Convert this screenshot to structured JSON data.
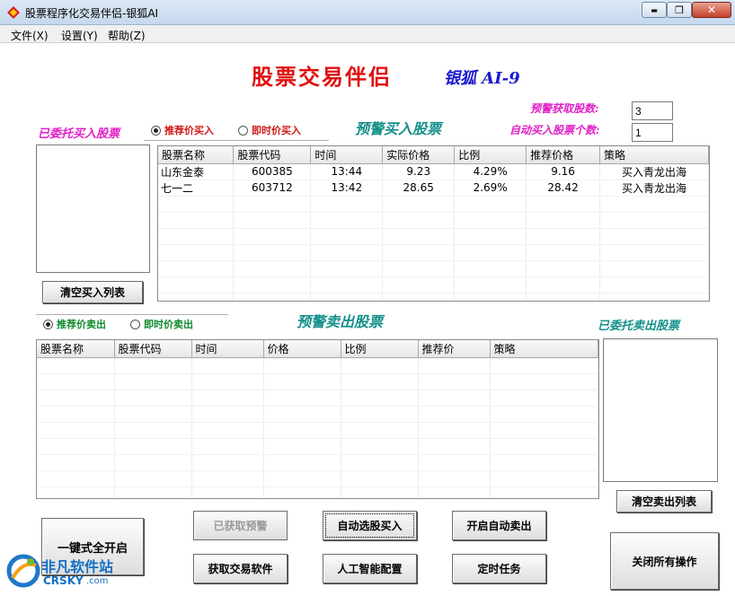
{
  "window": {
    "title": "股票程序化交易伴侣-银狐AI",
    "minimize_glyph": "▬",
    "maximize_glyph": "❐",
    "close_glyph": "✕"
  },
  "menu": [
    {
      "label": "文件(X)"
    },
    {
      "label": "设置(Y)"
    },
    {
      "label": "帮助(Z)"
    }
  ],
  "header": {
    "title": "股票交易伴侣",
    "brand": "银狐 AI-9"
  },
  "settings": {
    "alert_count_label": "预警获取股数:",
    "alert_count_value": "3",
    "auto_buy_label": "自动买入股票个数:",
    "auto_buy_value": "1"
  },
  "buy": {
    "committed_label": "已委托买入股票",
    "radio_recommended": "推荐价买入",
    "radio_instant": "即时价买入",
    "section_title": "预警买入股票",
    "clear_button": "清空买入列表",
    "columns": [
      "股票名称",
      "股票代码",
      "时间",
      "实际价格",
      "比例",
      "推荐价格",
      "策略"
    ],
    "rows": [
      [
        "山东金泰",
        "600385",
        "13:44",
        "9.23",
        "4.29%",
        "9.16",
        "买入青龙出海"
      ],
      [
        "七一二",
        "603712",
        "13:42",
        "28.65",
        "2.69%",
        "28.42",
        "买入青龙出海"
      ]
    ]
  },
  "sell": {
    "radio_recommended": "推荐价卖出",
    "radio_instant": "即时价卖出",
    "section_title": "预警卖出股票",
    "committed_label": "已委托卖出股票",
    "clear_button": "清空卖出列表",
    "columns": [
      "股票名称",
      "股票代码",
      "时间",
      "价格",
      "比例",
      "推荐价",
      "策略"
    ],
    "rows": []
  },
  "buttons": {
    "one_key_start": "一键式全开启",
    "alert_obtained": "已获取预警",
    "auto_select_buy": "自动选股买入",
    "auto_sell": "开启自动卖出",
    "close_all": "关闭所有操作",
    "get_software": "获取交易软件",
    "ai_config": "人工智能配置",
    "timed_task": "定时任务"
  },
  "watermark": {
    "brand": "非凡软件站",
    "domain": "CRSKY",
    "suffix": ".com"
  },
  "colors": {
    "title_red": "#e01010",
    "brand_blue": "#1a1ad0",
    "magenta": "#e020c8",
    "teal": "#14908a",
    "radio_red": "#d01818",
    "radio_green": "#0e8a2a"
  }
}
